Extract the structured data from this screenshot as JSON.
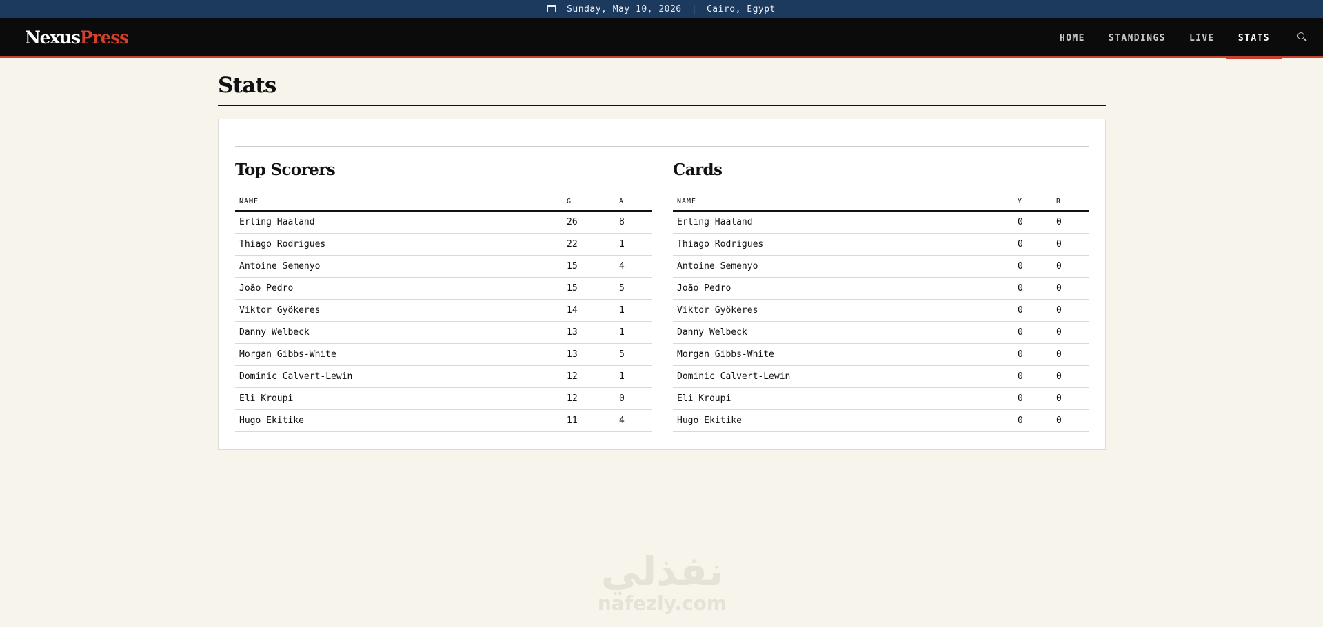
{
  "topbar": {
    "date": "Sunday, May 10, 2026",
    "separator": "|",
    "location": "Cairo, Egypt"
  },
  "brand": {
    "part1": "Nexus",
    "part2": "Press",
    "colors": {
      "part1": "#ffffff",
      "part2": "#d2402e"
    }
  },
  "nav": {
    "items": [
      {
        "label": "HOME",
        "active": false
      },
      {
        "label": "STANDINGS",
        "active": false
      },
      {
        "label": "LIVE",
        "active": false
      },
      {
        "label": "STATS",
        "active": true
      }
    ],
    "search_icon": "search-icon"
  },
  "colors": {
    "accent": "#c8402f",
    "topbar": "#1c3a5e",
    "nav": "#0b0b0b",
    "background": "#f7f4ec"
  },
  "page": {
    "title": "Stats"
  },
  "scorers": {
    "title": "Top Scorers",
    "columns": [
      "NAME",
      "G",
      "A"
    ],
    "rows": [
      {
        "name": "Erling Haaland",
        "g": "26",
        "a": "8"
      },
      {
        "name": "Thiago Rodrigues",
        "g": "22",
        "a": "1"
      },
      {
        "name": "Antoine Semenyo",
        "g": "15",
        "a": "4"
      },
      {
        "name": "João Pedro",
        "g": "15",
        "a": "5"
      },
      {
        "name": "Viktor Gyökeres",
        "g": "14",
        "a": "1"
      },
      {
        "name": "Danny Welbeck",
        "g": "13",
        "a": "1"
      },
      {
        "name": "Morgan Gibbs-White",
        "g": "13",
        "a": "5"
      },
      {
        "name": "Dominic Calvert-Lewin",
        "g": "12",
        "a": "1"
      },
      {
        "name": "Eli Kroupi",
        "g": "12",
        "a": "0"
      },
      {
        "name": "Hugo Ekitike",
        "g": "11",
        "a": "4"
      }
    ]
  },
  "cards": {
    "title": "Cards",
    "columns": [
      "NAME",
      "Y",
      "R"
    ],
    "rows": [
      {
        "name": "Erling Haaland",
        "y": "0",
        "r": "0"
      },
      {
        "name": "Thiago Rodrigues",
        "y": "0",
        "r": "0"
      },
      {
        "name": "Antoine Semenyo",
        "y": "0",
        "r": "0"
      },
      {
        "name": "João Pedro",
        "y": "0",
        "r": "0"
      },
      {
        "name": "Viktor Gyökeres",
        "y": "0",
        "r": "0"
      },
      {
        "name": "Danny Welbeck",
        "y": "0",
        "r": "0"
      },
      {
        "name": "Morgan Gibbs-White",
        "y": "0",
        "r": "0"
      },
      {
        "name": "Dominic Calvert-Lewin",
        "y": "0",
        "r": "0"
      },
      {
        "name": "Eli Kroupi",
        "y": "0",
        "r": "0"
      },
      {
        "name": "Hugo Ekitike",
        "y": "0",
        "r": "0"
      }
    ]
  },
  "watermark": {
    "arabic": "نفذلي",
    "latin": "nafezly.com"
  }
}
